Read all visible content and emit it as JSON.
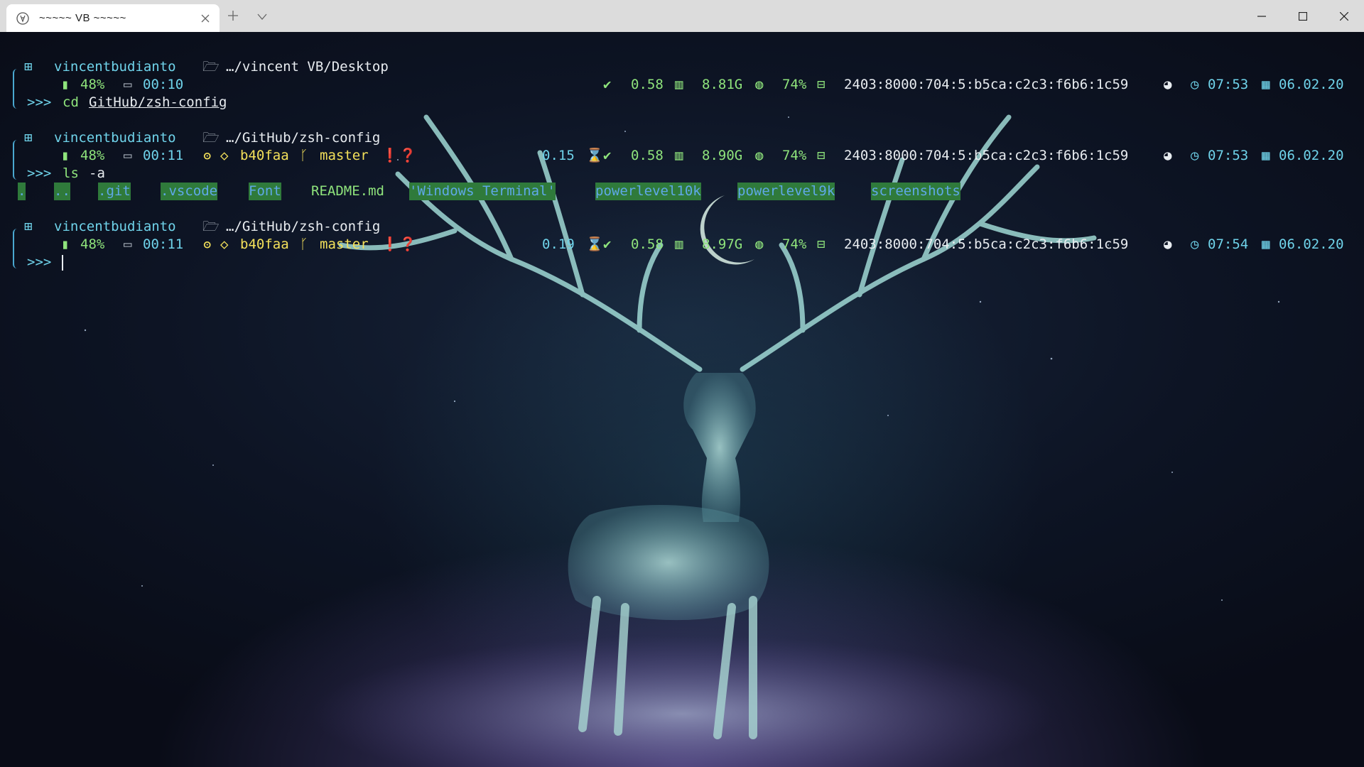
{
  "window": {
    "tab_title": "~~~~~ VB ~~~~~",
    "tab_icon": "linux-tux-icon",
    "buttons": [
      "minimize",
      "maximize",
      "close"
    ]
  },
  "colors": {
    "accent_cyan": "#6fd3ea",
    "accent_green": "#8fe47c",
    "accent_yellow": "#f3e05a",
    "dir_highlight_bg": "#2f7a3b"
  },
  "prompts": [
    {
      "user": "vincentbudianto",
      "path": "…/vincent VB/Desktop",
      "battery": "48%",
      "uptime": "00:10",
      "git_hash": "",
      "git_branch": "",
      "exec_time": "",
      "load": "0.58",
      "ram": "8.81G",
      "disk": "74%",
      "ip": "2403:8000:704:5:b5ca:c2c3:f6b6:1c59",
      "time": "07:53",
      "date": "06.02.20",
      "cmd_name": "cd",
      "cmd_arg": "GitHub/zsh-config"
    },
    {
      "user": "vincentbudianto",
      "path": "…/GitHub/zsh-config",
      "battery": "48%",
      "uptime": "00:11",
      "git_hash": "b40faa",
      "git_branch": "master",
      "exec_time": "0.15",
      "load": "0.58",
      "ram": "8.90G",
      "disk": "74%",
      "ip": "2403:8000:704:5:b5ca:c2c3:f6b6:1c59",
      "time": "07:53",
      "date": "06.02.20",
      "cmd_name": "ls",
      "cmd_arg": "-a"
    },
    {
      "user": "vincentbudianto",
      "path": "…/GitHub/zsh-config",
      "battery": "48%",
      "uptime": "00:11",
      "git_hash": "b40faa",
      "git_branch": "master",
      "exec_time": "0.19",
      "load": "0.58",
      "ram": "8.97G",
      "disk": "74%",
      "ip": "2403:8000:704:5:b5ca:c2c3:f6b6:1c59",
      "time": "07:54",
      "date": "06.02.20",
      "cmd_name": "",
      "cmd_arg": ""
    }
  ],
  "prompt_symbol": ">>>",
  "ls_output": [
    ".",
    "..",
    ".git",
    ".vscode",
    "Font",
    "README.md",
    "'Windows Terminal'",
    "powerlevel10k",
    "powerlevel9k",
    "screenshots"
  ]
}
